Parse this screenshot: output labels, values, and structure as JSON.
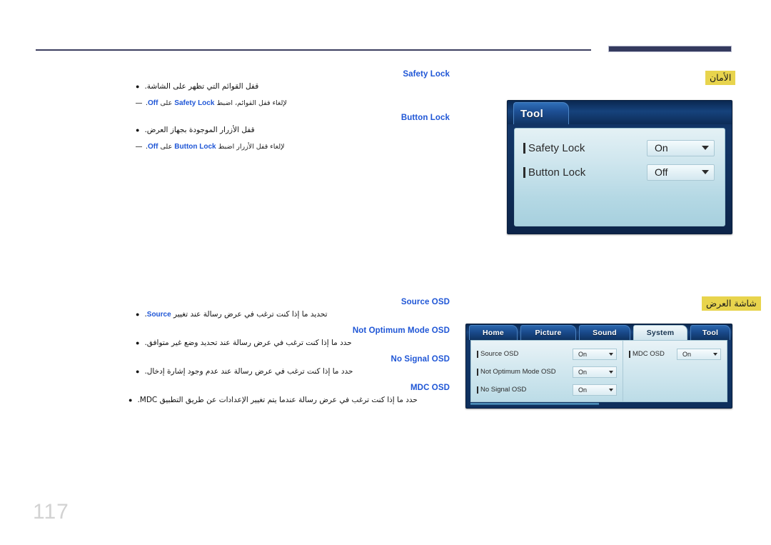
{
  "page": {
    "number": "117"
  },
  "sections": [
    {
      "tag": "الأمان",
      "items": [
        {
          "heading": "Safety Lock",
          "bullet": "قفل القوائم التي تظهر على الشاشة.",
          "note_before": "لإلغاء قفل القوائم، اضبط",
          "note_kw1": "Safety Lock",
          "note_middle": "على",
          "note_kw2": "Off",
          "note_after": "."
        },
        {
          "heading": "Button Lock",
          "bullet": "قفل الأزرار الموجودة بجهاز العرض.",
          "note_before": "لإلغاء قفل الأزرار اضبط",
          "note_kw1": "Button Lock",
          "note_middle": "على",
          "note_kw2": "Off",
          "note_after": "."
        }
      ]
    },
    {
      "tag": "شاشة العرض",
      "items": [
        {
          "heading": "Source OSD",
          "bullet_before": "تحديد ما إذا كنت ترغب في عرض رسالة عند تغيير",
          "bullet_kw": "Source",
          "bullet_after": "."
        },
        {
          "heading": "Not Optimum Mode OSD",
          "bullet": "حدد ما إذا كنت ترغب في عرض رسالة عند تحديد وضع غير متوافق."
        },
        {
          "heading": "No Signal OSD",
          "bullet": "حدد ما إذا كنت ترغب في عرض رسالة عند عدم وجود إشارة إدخال."
        },
        {
          "heading": "MDC OSD",
          "bullet": "حدد ما إذا كنت ترغب في عرض رسالة عندما يتم تغيير الإعدادات عن طريق التطبيق MDC."
        }
      ]
    }
  ],
  "osd_tool": {
    "tab_label": "Tool",
    "rows": [
      {
        "label": "Safety Lock",
        "value": "On"
      },
      {
        "label": "Button Lock",
        "value": "Off"
      }
    ]
  },
  "osd_system": {
    "tabs": [
      {
        "label": "Home",
        "active": false
      },
      {
        "label": "Picture",
        "active": false
      },
      {
        "label": "Sound",
        "active": false
      },
      {
        "label": "System",
        "active": true
      },
      {
        "label": "Tool",
        "active": false
      }
    ],
    "left_rows": [
      {
        "label": "Source OSD",
        "value": "On"
      },
      {
        "label": "Not Optimum Mode OSD",
        "value": "On"
      },
      {
        "label": "No Signal OSD",
        "value": "On"
      }
    ],
    "right_rows": [
      {
        "label": "MDC OSD",
        "value": "On"
      }
    ]
  },
  "colors": {
    "heading_blue": "#1f56d6",
    "tag_yellow": "#e8d44d",
    "rule_navy": "#343a5e",
    "page_num_gray": "#d2d2d2"
  }
}
